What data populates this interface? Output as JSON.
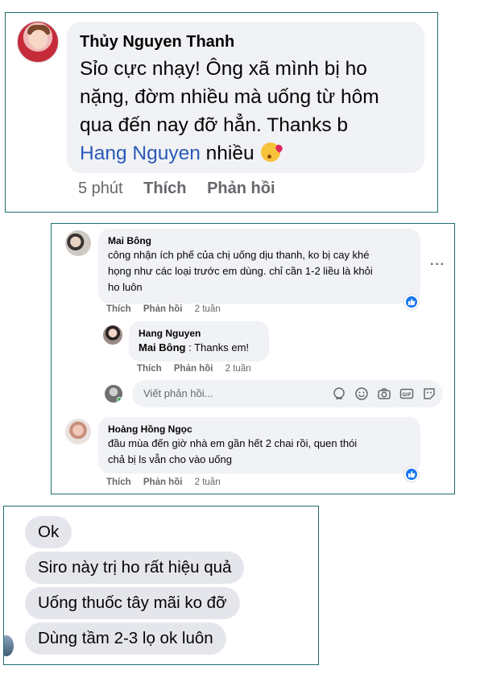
{
  "panel1": {
    "name": "Thủy Nguyen Thanh",
    "text_lines": [
      "Sỉo cực nhạy! Ông xã mình bị ho",
      "nặng, đờm nhiều mà uống từ hôm",
      "qua đến nay đỡ hẳn. Thanks b"
    ],
    "mention": "Hang Nguyen",
    "text_after_mention": "nhiều",
    "emoji_icon": "face-blowing-kiss-icon",
    "time": "5 phút",
    "like_label": "Thích",
    "reply_label": "Phản hồi"
  },
  "panel2": {
    "comment1": {
      "name": "Mai Bông",
      "text_lines": [
        "công nhận ích phế của chị uống dịu thanh, ko bị cay khé",
        "họng như các loại trước em dùng. chỉ cần 1-2 liều là khỏi",
        "ho luôn"
      ],
      "like_label": "Thích",
      "reply_label": "Phản hồi",
      "time": "2 tuần"
    },
    "reply1": {
      "name": "Hang Nguyen",
      "mention": "Mai Bông",
      "text": " : Thanks em!",
      "like_label": "Thích",
      "reply_label": "Phản hồi",
      "time": "2 tuần"
    },
    "reply_input": {
      "placeholder": "Viết phản hồi..."
    },
    "comment2": {
      "name": "Hoàng Hồng Ngọc",
      "text_lines": [
        "đầu mùa đến giờ nhà em gần hết 2 chai rồi, quen thói",
        "chả bị ls vẫn cho vào uống"
      ],
      "like_label": "Thích",
      "reply_label": "Phản hồi",
      "time": "2 tuần"
    },
    "more_label": "···"
  },
  "panel3": {
    "messages": [
      "Ok",
      "Siro này trị ho rất hiệu quả",
      "Uống thuốc tây mãi ko đỡ",
      "Dùng tầm 2-3 lọ ok luôn"
    ]
  },
  "colors": {
    "link": "#2a5ab8",
    "like_blue": "#1877f2",
    "bubble_bg": "#f0f2f5",
    "message_bg": "#e4e6eb",
    "panel_border": "#1f6f6b",
    "muted_text": "#65676b"
  }
}
